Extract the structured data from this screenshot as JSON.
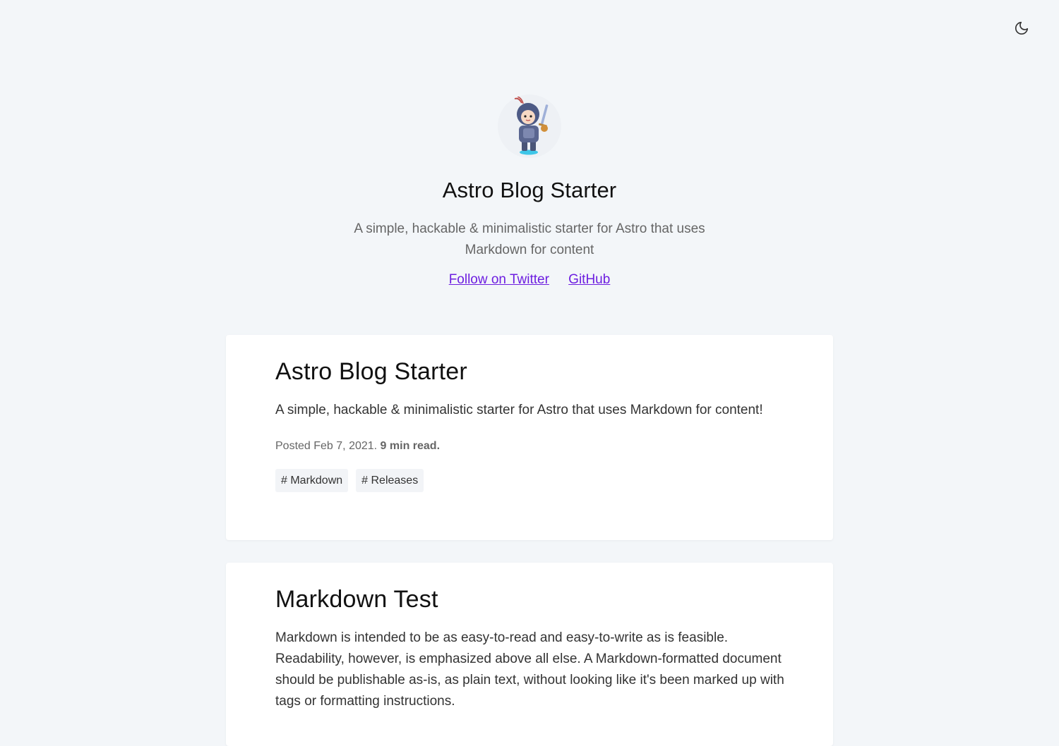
{
  "header": {
    "theme_toggle_icon": "moon-icon"
  },
  "hero": {
    "avatar_icon": "astronaut-avatar",
    "title": "Astro Blog Starter",
    "description": "A simple, hackable & minimalistic starter for Astro that uses Markdown for content",
    "links": [
      {
        "label": "Follow on Twitter"
      },
      {
        "label": "GitHub"
      }
    ],
    "link_color": "#6d1ee0"
  },
  "posts": [
    {
      "title": "Astro Blog Starter",
      "excerpt": "A simple, hackable & minimalistic starter for Astro that uses Markdown for content!",
      "posted_prefix": "Posted Feb 7, 2021. ",
      "read_time": "9 min read.",
      "tags": [
        "# Markdown",
        "# Releases"
      ]
    },
    {
      "title": "Markdown Test",
      "excerpt": "Markdown is intended to be as easy-to-read and easy-to-write as is feasible. Readability, however, is emphasized above all else. A Markdown-formatted document should be publishable as-is, as plain text, without looking like it's been marked up with tags or formatting instructions."
    }
  ]
}
